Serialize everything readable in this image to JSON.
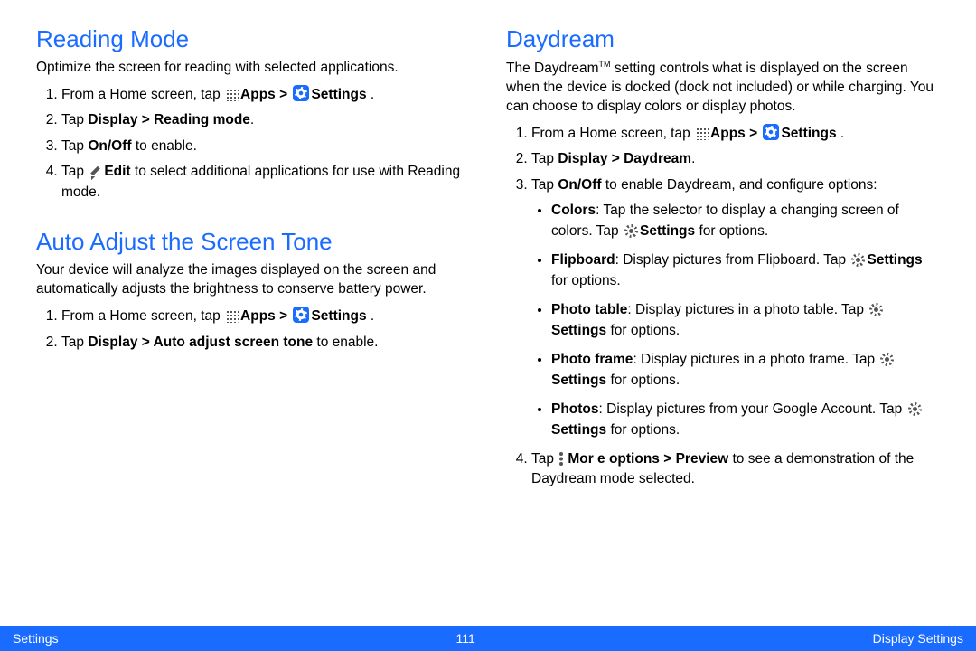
{
  "left": {
    "reading": {
      "heading": "Reading Mode",
      "intro": "Optimize the screen for reading with selected applications.",
      "step1_a": "From a Home screen, tap ",
      "step1_apps": "Apps > ",
      "step1_settings": "Settings",
      "step1_end": " .",
      "step2_a": "Tap ",
      "step2_b": "Display > Reading mode",
      "step2_c": ".",
      "step3_a": "Tap ",
      "step3_b": "On/Off",
      "step3_c": " to enable.",
      "step4_a": "Tap ",
      "step4_b": "Edit",
      "step4_c": " to select additional applications for use with Reading mode."
    },
    "auto": {
      "heading": "Auto Adjust the Screen Tone",
      "intro": "Your device will analyze the images displayed on the screen and automatically adjusts the brightness to conserve battery power.",
      "step1_a": "From a Home screen, tap ",
      "step1_apps": "Apps > ",
      "step1_settings": "Settings",
      "step1_end": " .",
      "step2_a": "Tap ",
      "step2_b": "Display > Auto adjust screen tone",
      "step2_c": " to enable."
    }
  },
  "right": {
    "daydream": {
      "heading": "Daydream",
      "intro_a": "The Daydream",
      "intro_tm": "TM",
      "intro_b": " setting controls what is displayed on the screen when the device is docked (dock not included) or while charging. You can choose to display colors or display photos.",
      "step1_a": "From a Home screen, tap ",
      "step1_apps": "Apps > ",
      "step1_settings": "Settings",
      "step1_end": " .",
      "step2_a": "Tap ",
      "step2_b": "Display > Daydream",
      "step2_c": ".",
      "step3_a": "Tap ",
      "step3_b": "On/Off",
      "step3_c": " to enable Daydream, and configure options:",
      "b1_a": "Colors",
      "b1_b": ": Tap the selector to display a changing screen of colors. Tap ",
      "b1_c": "Settings",
      "b1_d": " for options.",
      "b2_a": "Flipboard",
      "b2_b": ": Display pictures from Flipboard. Tap ",
      "b2_c": "Settings",
      "b2_d": " for options.",
      "b3_a": "Photo table",
      "b3_b": ": Display pictures in a photo table. Tap ",
      "b3_c": "Settings",
      "b3_d": "  for options.",
      "b4_a": "Photo frame",
      "b4_b": ": Display pictures in a photo frame. Tap ",
      "b4_c": "Settings",
      "b4_d": "  for options.",
      "b5_a": "Photos",
      "b5_b": ": Display pictures from your Google Account. Tap ",
      "b5_c": "Settings",
      "b5_d": " for options.",
      "step4_a": "Tap ",
      "step4_b": "Mor e options > Preview",
      "step4_c": " to see a demonstration of the Daydream mode selected."
    }
  },
  "footer": {
    "left": "Settings",
    "center": "111",
    "right": "Display Settings"
  }
}
